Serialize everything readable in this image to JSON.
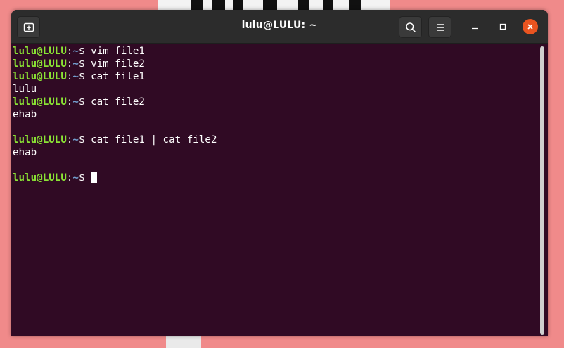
{
  "window": {
    "title": "lulu@LULU: ~",
    "buttons": {
      "new_tab_icon": "new-tab-icon",
      "search_icon": "search-icon",
      "menu_icon": "hamburger-menu-icon",
      "minimize_icon": "minimize-icon",
      "maximize_icon": "maximize-icon",
      "close_icon": "close-icon"
    }
  },
  "terminal": {
    "prompt_user": "lulu@LULU",
    "prompt_colon": ":",
    "prompt_path": "~",
    "prompt_symbol": "$ ",
    "lines": [
      {
        "type": "cmd",
        "text": "vim file1"
      },
      {
        "type": "cmd",
        "text": "vim file2"
      },
      {
        "type": "cmd",
        "text": "cat file1"
      },
      {
        "type": "out",
        "text": "lulu"
      },
      {
        "type": "cmd",
        "text": "cat file2"
      },
      {
        "type": "out",
        "text": "ehab"
      },
      {
        "type": "out",
        "text": ""
      },
      {
        "type": "cmd",
        "text": "cat file1 | cat file2"
      },
      {
        "type": "out",
        "text": "ehab"
      },
      {
        "type": "out",
        "text": ""
      },
      {
        "type": "prompt",
        "text": ""
      }
    ]
  },
  "colors": {
    "terminal_bg": "#300a24",
    "titlebar_bg": "#2c2c2c",
    "prompt_user": "#8ae234",
    "prompt_path": "#729fcf",
    "close_button": "#e95420"
  }
}
